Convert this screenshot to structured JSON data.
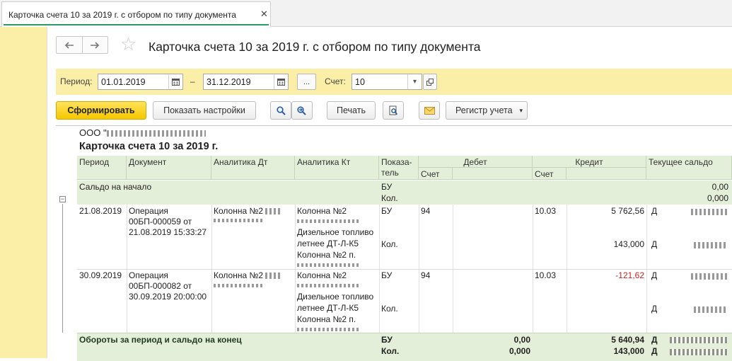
{
  "tab": {
    "title": "Карточка счета 10 за 2019 г. с отбором по типу документа",
    "close": "✕"
  },
  "header": {
    "back": "🡐",
    "forward": "🡒",
    "title": "Карточка счета 10 за 2019 г. с отбором по типу документа"
  },
  "filters": {
    "period_label": "Период:",
    "date_from": "01.01.2019",
    "dash": "–",
    "date_to": "31.12.2019",
    "ellipsis": "...",
    "account_label": "Счет:",
    "account_value": "10"
  },
  "toolbar": {
    "generate": "Сформировать",
    "show_settings": "Показать настройки",
    "print": "Печать",
    "register": "Регистр учета"
  },
  "report": {
    "org": "ООО \"",
    "title": "Карточка счета 10 за 2019 г.",
    "columns": {
      "period": "Период",
      "document": "Документ",
      "analytics_dt": "Аналитика Дт",
      "analytics_kt": "Аналитика Кт",
      "indicator_1": "Показа-",
      "indicator_2": "тель",
      "debit": "Дебет",
      "debit_account": "Счет",
      "credit": "Кредит",
      "credit_account": "Счет",
      "balance": "Текущее сальдо"
    },
    "opening": {
      "label": "Сальдо на начало",
      "ind_1": "БУ",
      "ind_2": "Кол.",
      "val_1": "0,00",
      "val_2": "0,000"
    },
    "rows": [
      {
        "date": "21.08.2019",
        "doc_1": "Операция",
        "doc_2": "00БП-000059 от",
        "doc_3": "21.08.2019 15:33:27",
        "dt_1": "Колонна №2",
        "kt_1": "Колонна №2",
        "kt_3": "Дизельное топливо",
        "kt_4": "летнее ДТ-Л-К5",
        "kt_5": "Колонна №2 п.",
        "ind_1": "БУ",
        "ind_2": "Кол.",
        "debit_account": "94",
        "credit_account": "10.03",
        "credit_1": "5 762,56",
        "credit_2": "143,000",
        "bal_1": "Д",
        "bal_2": "Д"
      },
      {
        "date": "30.09.2019",
        "doc_1": "Операция",
        "doc_2": "00БП-000082 от",
        "doc_3": "30.09.2019 20:00:00",
        "dt_1": "Колонна №2",
        "kt_1": "Колонна №2",
        "kt_3": "Дизельное топливо",
        "kt_4": "летнее ДТ-Л-К5",
        "kt_5": "Колонна №2 п.",
        "ind_1": "БУ",
        "ind_2": "Кол.",
        "debit_account": "94",
        "credit_account": "10.03",
        "credit_1": "-121,62",
        "bal_1": "Д",
        "bal_2": "Д"
      }
    ],
    "totals": {
      "label": "Обороты за период и сальдо на конец",
      "ind_1": "БУ",
      "ind_2": "Кол.",
      "debit_1": "0,00",
      "debit_2": "0,000",
      "credit_1": "5 640,94",
      "credit_2": "143,000",
      "bal_1": "Д",
      "bal_2": "Д"
    }
  },
  "colors": {
    "accent_yellow": "#fbeea6",
    "table_header": "#e4efd9",
    "tab_underline": "#2d9b62",
    "negative": "#d02020"
  }
}
